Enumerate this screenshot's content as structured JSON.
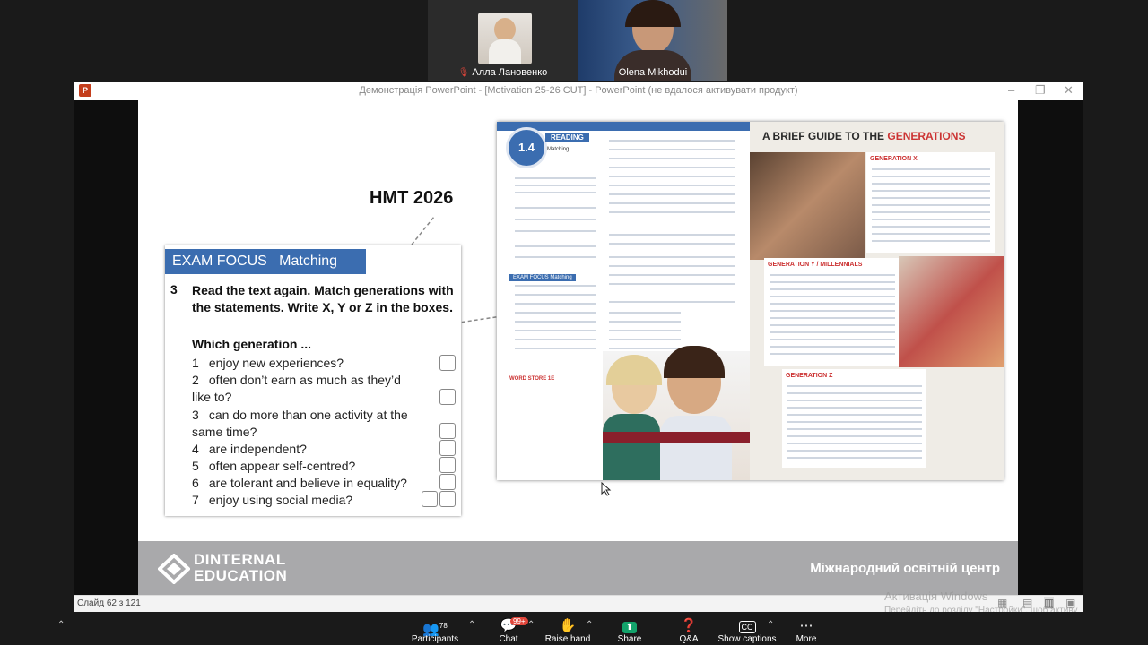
{
  "participants": [
    {
      "name": "Алла Лановенко",
      "muted": true
    },
    {
      "name": "Olena Mikhodui",
      "muted": false
    }
  ],
  "ppt_window": {
    "title": "Демонстрація PowerPoint - [Motivation 25-26 CUT] - PowerPoint (не вдалося активувати продукт)",
    "icon": "P"
  },
  "slide": {
    "annotation": "НМТ 2026",
    "exam_focus": {
      "header_a": "EXAM FOCUS",
      "header_b": "Matching",
      "number": "3",
      "instruction": "Read the text again. Match generations with the statements. Write X, Y or Z in the boxes.",
      "subheading": "Which generation ...",
      "items": [
        {
          "n": "1",
          "text": "enjoy new experiences?"
        },
        {
          "n": "2",
          "text": "often don’t earn as much as they’d like to?"
        },
        {
          "n": "3",
          "text": "can do more than one activity at the same time?"
        },
        {
          "n": "4",
          "text": "are independent?"
        },
        {
          "n": "5",
          "text": "often appear self-centred?"
        },
        {
          "n": "6",
          "text": "are tolerant and believe in equality?"
        },
        {
          "n": "7",
          "text": "enjoy using social media?"
        }
      ]
    },
    "book": {
      "lesson": "1.4",
      "section": "READING",
      "subsection": "Matching",
      "guide_title_a": "A BRIEF GUIDE TO THE",
      "guide_title_b": "GENERATIONS",
      "gen_x": "GENERATION X",
      "gen_y": "GENERATION Y / MILLENNIALS",
      "gen_z": "GENERATION Z",
      "exam_focus_small": "EXAM FOCUS Matching",
      "word_store": "WORD STORE 1E"
    },
    "footer": {
      "logo_a": "DINTERNAL",
      "logo_b": "EDUCATION",
      "tagline": "Міжнародний освітній центр"
    }
  },
  "status_bar": {
    "slide_info": "Слайд 62 з 121",
    "watermark_a": "Активація Windows",
    "watermark_b": "Перейдіть до розділу \"Настройки\", щоб активу"
  },
  "toolbar": [
    {
      "name": "participants",
      "label": "Participants",
      "badge": "78",
      "icon": "people-icon"
    },
    {
      "name": "chat",
      "label": "Chat",
      "badge": "99+",
      "icon": "chat-icon"
    },
    {
      "name": "raise-hand",
      "label": "Raise hand",
      "icon": "hand-icon"
    },
    {
      "name": "share",
      "label": "Share",
      "icon": "share-icon"
    },
    {
      "name": "qa",
      "label": "Q&A",
      "icon": "qa-icon"
    },
    {
      "name": "captions",
      "label": "Show captions",
      "icon": "cc-icon"
    },
    {
      "name": "more",
      "label": "More",
      "icon": "more-icon"
    }
  ],
  "colors": {
    "accent": "#3b6db0",
    "brand_red": "#c33",
    "share_green": "#13a36b",
    "chat_badge": "#e0453a"
  }
}
